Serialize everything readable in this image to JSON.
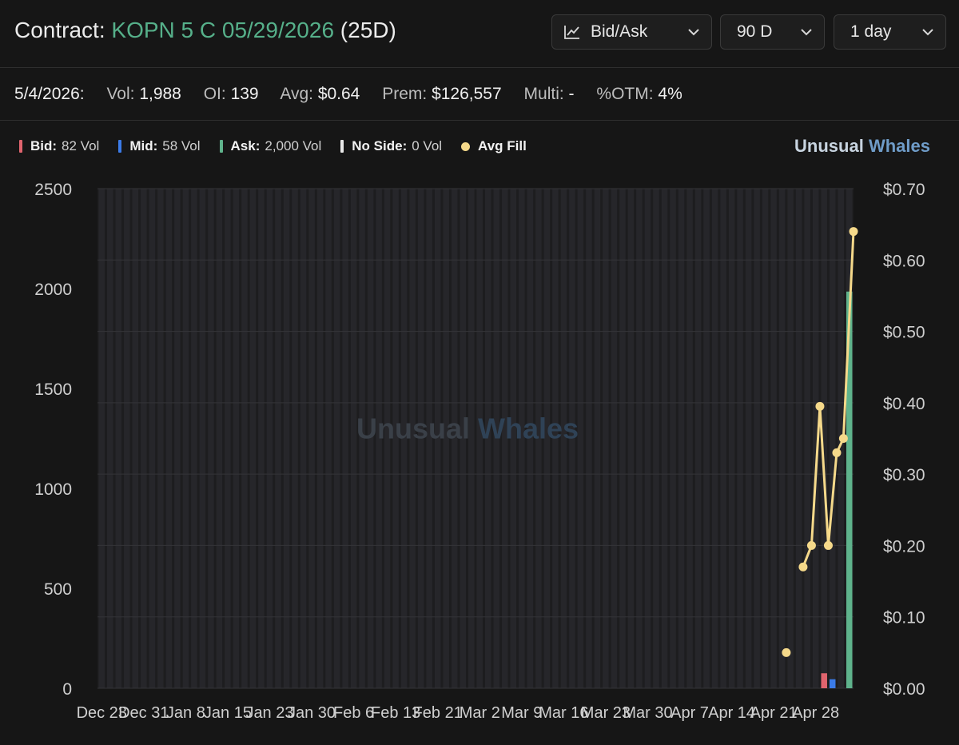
{
  "header": {
    "title_prefix": "Contract:",
    "contract": "KOPN 5 C 05/29/2026",
    "dte": "(25D)",
    "controls": [
      {
        "label": "Bid/Ask",
        "icon": "line-chart-icon"
      },
      {
        "label": "90 D"
      },
      {
        "label": "1 day"
      }
    ]
  },
  "stats": {
    "date": "5/4/2026:",
    "items": [
      {
        "label": "Vol:",
        "value": "1,988"
      },
      {
        "label": "OI:",
        "value": "139"
      },
      {
        "label": "Avg:",
        "value": "$0.64"
      },
      {
        "label": "Prem:",
        "value": "$126,557"
      },
      {
        "label": "Multi:",
        "value": "-"
      },
      {
        "label": "%OTM:",
        "value": "4%"
      }
    ]
  },
  "legend": [
    {
      "name": "Bid:",
      "value": "82 Vol",
      "color": "#e0646e",
      "kind": "bar"
    },
    {
      "name": "Mid:",
      "value": "58 Vol",
      "color": "#3b7be8",
      "kind": "bar"
    },
    {
      "name": "Ask:",
      "value": "2,000 Vol",
      "color": "#5fb38c",
      "kind": "bar"
    },
    {
      "name": "No Side:",
      "value": "0 Vol",
      "color": "#e8e8e8",
      "kind": "bar"
    },
    {
      "name": "Avg Fill",
      "value": "",
      "color": "#f5d98a",
      "kind": "dot"
    }
  ],
  "brand": {
    "word1": "Unusual",
    "word2": "Whales"
  },
  "chart_data": {
    "type": "bar",
    "watermark": {
      "word1": "Unusual",
      "word2": "Whales"
    },
    "y_left": {
      "ticks": [
        "2500",
        "2000",
        "1500",
        "1000",
        "500",
        "0"
      ],
      "lim": [
        0,
        2500
      ]
    },
    "y_right": {
      "ticks": [
        "$0.70",
        "$0.60",
        "$0.50",
        "$0.40",
        "$0.30",
        "$0.20",
        "$0.10",
        "$0.00"
      ],
      "lim": [
        0,
        0.7
      ]
    },
    "x_ticks": [
      "Dec 23",
      "Dec 31",
      "Jan 8",
      "Jan 15",
      "Jan 23",
      "Jan 30",
      "Feb 6",
      "Feb 13",
      "Feb 21",
      "Mar 2",
      "Mar 9",
      "Mar 16",
      "Mar 23",
      "Mar 30",
      "Apr 7",
      "Apr 14",
      "Apr 21",
      "Apr 28"
    ],
    "n_slots": 90,
    "tick_slots": [
      0,
      5,
      10,
      15,
      20,
      25,
      30,
      35,
      40,
      45,
      50,
      55,
      60,
      65,
      70,
      75,
      80,
      85
    ],
    "volume_series": [
      {
        "name": "Bid",
        "color": "#e0646e",
        "points": [
          {
            "slot": 86,
            "value": 75
          }
        ]
      },
      {
        "name": "Mid",
        "color": "#3b7be8",
        "points": [
          {
            "slot": 87,
            "value": 45
          }
        ]
      },
      {
        "name": "Ask",
        "color": "#5fb38c",
        "points": [
          {
            "slot": 89,
            "value": 1985
          }
        ]
      }
    ],
    "avg_fill": {
      "name": "Avg Fill",
      "color": "#f5d98a",
      "points": [
        {
          "slot": 82,
          "value": 0.05,
          "isolated": true
        },
        {
          "slot": 84,
          "value": 0.17
        },
        {
          "slot": 85,
          "value": 0.2
        },
        {
          "slot": 86,
          "value": 0.395
        },
        {
          "slot": 87,
          "value": 0.2
        },
        {
          "slot": 88,
          "value": 0.33
        },
        {
          "slot": 88.8,
          "value": 0.35
        },
        {
          "slot": 90,
          "value": 0.64
        }
      ]
    }
  }
}
